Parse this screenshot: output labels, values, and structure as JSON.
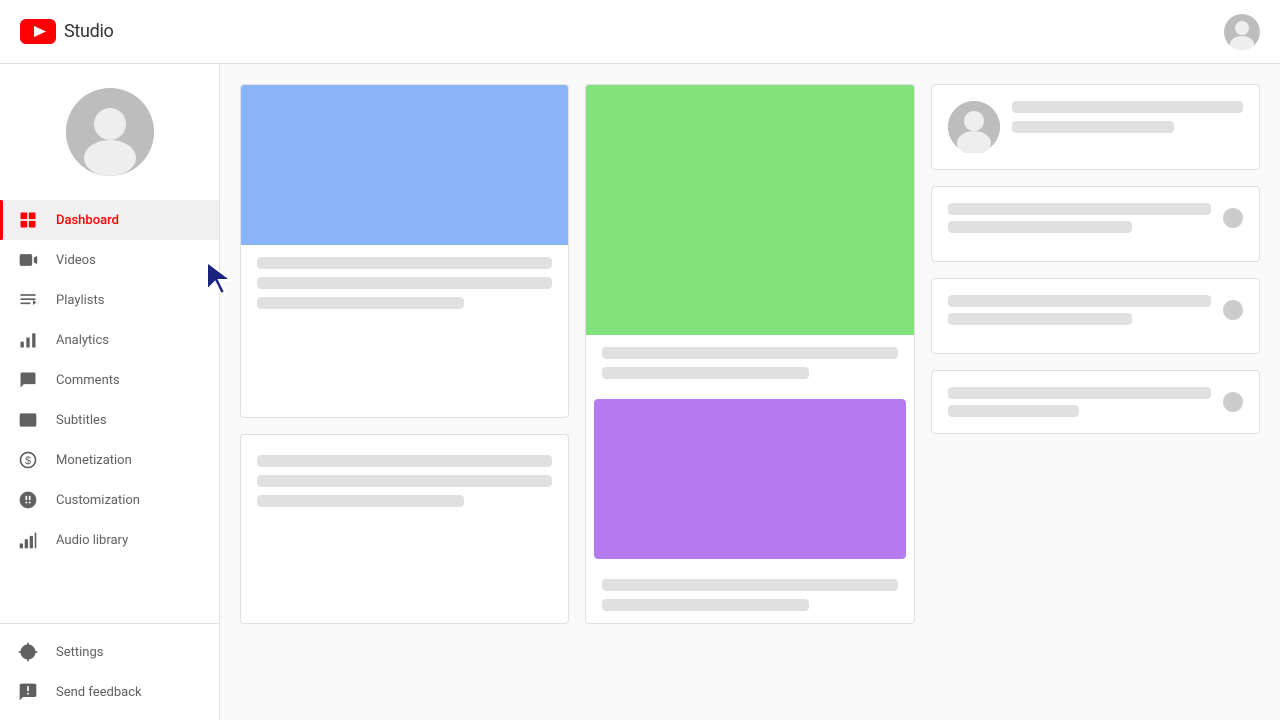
{
  "header": {
    "title": "Studio",
    "logo_alt": "YouTube Studio"
  },
  "sidebar": {
    "avatar_alt": "User avatar",
    "nav_items": [
      {
        "id": "dashboard",
        "label": "Dashboard",
        "icon": "dashboard-icon",
        "active": true
      },
      {
        "id": "videos",
        "label": "Videos",
        "icon": "videos-icon",
        "active": false
      },
      {
        "id": "playlists",
        "label": "Playlists",
        "icon": "playlists-icon",
        "active": false
      },
      {
        "id": "analytics",
        "label": "Analytics",
        "icon": "analytics-icon",
        "active": false
      },
      {
        "id": "comments",
        "label": "Comments",
        "icon": "comments-icon",
        "active": false
      },
      {
        "id": "subtitles",
        "label": "Subtitles",
        "icon": "subtitles-icon",
        "active": false
      },
      {
        "id": "monetization",
        "label": "Monetization",
        "icon": "monetization-icon",
        "active": false
      },
      {
        "id": "customization",
        "label": "Customization",
        "icon": "customization-icon",
        "active": false
      },
      {
        "id": "audio-library",
        "label": "Audio library",
        "icon": "audio-library-icon",
        "active": false
      }
    ],
    "bottom_items": [
      {
        "id": "settings",
        "label": "Settings",
        "icon": "settings-icon"
      },
      {
        "id": "send-feedback",
        "label": "Send feedback",
        "icon": "feedback-icon"
      }
    ]
  }
}
